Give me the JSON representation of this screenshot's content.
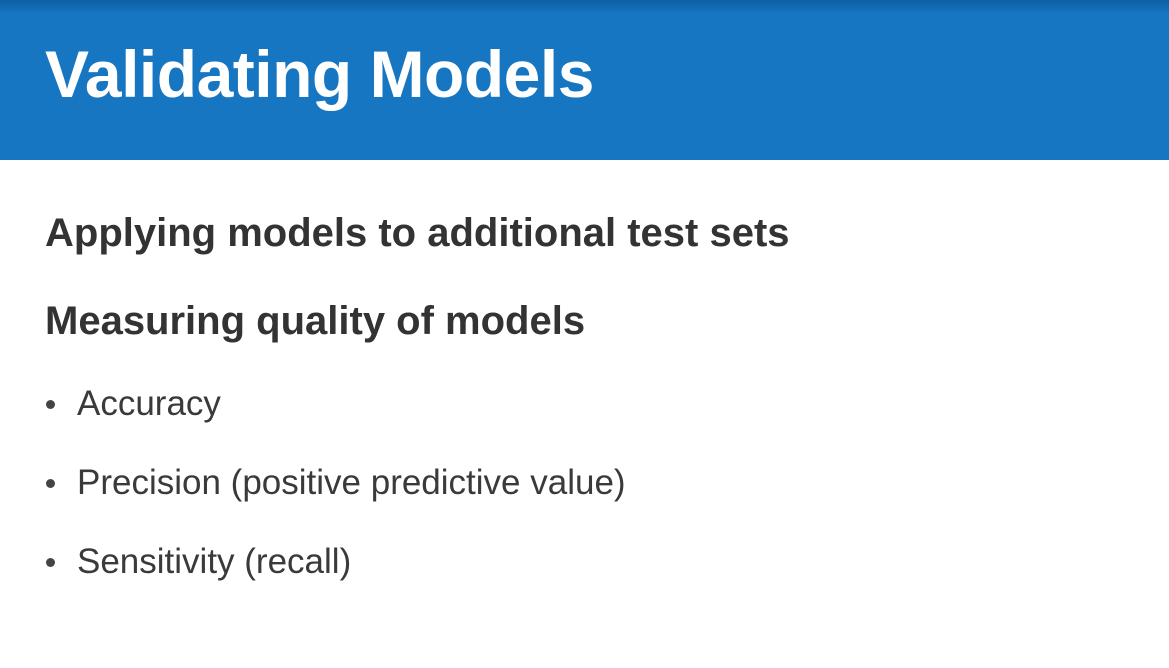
{
  "header": {
    "title": "Validating Models"
  },
  "sections": [
    {
      "heading": "Applying models to additional test sets"
    },
    {
      "heading": "Measuring quality of models"
    }
  ],
  "bullets": [
    {
      "text": "Accuracy"
    },
    {
      "text": "Precision (positive predictive value)"
    },
    {
      "text": "Sensitivity (recall)"
    }
  ],
  "colors": {
    "header_background": "#1776c1",
    "header_text": "#ffffff",
    "body_text": "#333333"
  }
}
